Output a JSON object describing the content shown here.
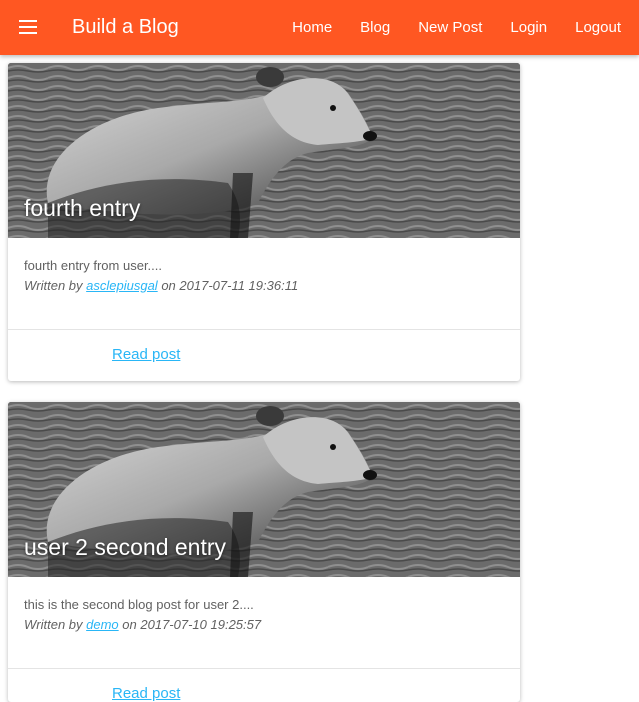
{
  "navbar": {
    "brand": "Build a Blog",
    "bg_color": "#ff5722",
    "menu_icon": "hamburger-menu-icon",
    "links": [
      "Home",
      "Blog",
      "New Post",
      "Login",
      "Logout"
    ]
  },
  "posts": [
    {
      "title": "fourth entry",
      "excerpt": "fourth entry from user....",
      "written_by": "Written by",
      "author": "asclepiusgal",
      "on": "on",
      "date": "2017-07-11 19:36:11",
      "read_label": "Read post"
    },
    {
      "title": "user 2 second entry",
      "excerpt": "this is the second blog post for user 2....",
      "written_by": "Written by",
      "author": "demo",
      "on": "on",
      "date": "2017-07-10 19:25:57",
      "read_label": "Read post"
    }
  ],
  "colors": {
    "accent": "#ff5722",
    "link": "#29b6f6",
    "text": "#616161"
  }
}
